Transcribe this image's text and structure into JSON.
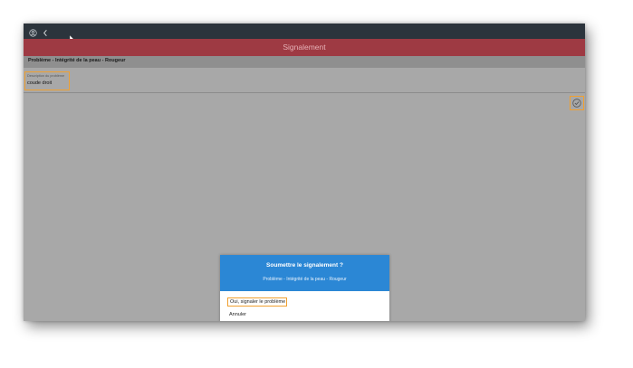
{
  "topbar": {
    "profile_icon": "user-circle-icon",
    "back_icon": "chevron-left-icon"
  },
  "header": {
    "title": "Signalement"
  },
  "breadcrumb": {
    "text": "Problème - Intégrité de la peau - Rougeur"
  },
  "form": {
    "description_label": "Description du problème",
    "description_value": "coude droit",
    "confirm_icon": "check-circle-icon"
  },
  "dialog": {
    "title": "Soumettre le signalement ?",
    "subtitle": "Problème - Intégrité de la peau - Rougeur",
    "confirm_label": "Oui, signaler le problème",
    "cancel_label": "Annuler"
  },
  "colors": {
    "topbar": "#2c343c",
    "header": "#9e3a43",
    "dialog_header": "#2b87d5",
    "highlight": "#f0a030"
  }
}
